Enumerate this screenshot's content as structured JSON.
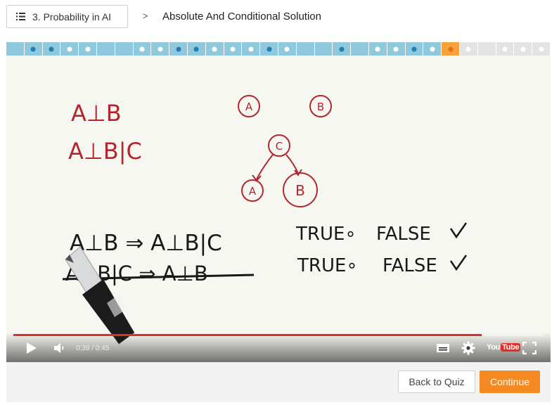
{
  "header": {
    "lesson_label": "3. Probability in AI",
    "separator": ">",
    "concept_title": "Absolute And Conditional Solution"
  },
  "progress": {
    "colors": {
      "done": "#90c9de",
      "dot_done": "#1e7fb5",
      "dot_quiz": "#ffffff",
      "current": "#f7a23b",
      "dot_current": "#e2701e",
      "todo": "#e3e3e3",
      "dot_todo": "#ffffff"
    },
    "segments": [
      {
        "state": "done",
        "dot": "none"
      },
      {
        "state": "done",
        "dot": "video"
      },
      {
        "state": "done",
        "dot": "video"
      },
      {
        "state": "done",
        "dot": "quiz"
      },
      {
        "state": "done",
        "dot": "quiz"
      },
      {
        "state": "done",
        "dot": "none"
      },
      {
        "state": "done",
        "dot": "none"
      },
      {
        "state": "done",
        "dot": "quiz"
      },
      {
        "state": "done",
        "dot": "quiz"
      },
      {
        "state": "done",
        "dot": "video"
      },
      {
        "state": "done",
        "dot": "video"
      },
      {
        "state": "done",
        "dot": "quiz"
      },
      {
        "state": "done",
        "dot": "quiz"
      },
      {
        "state": "done",
        "dot": "quiz"
      },
      {
        "state": "done",
        "dot": "video"
      },
      {
        "state": "done",
        "dot": "quiz"
      },
      {
        "state": "done",
        "dot": "none"
      },
      {
        "state": "done",
        "dot": "none"
      },
      {
        "state": "done",
        "dot": "video"
      },
      {
        "state": "done",
        "dot": "none"
      },
      {
        "state": "done",
        "dot": "quiz"
      },
      {
        "state": "done",
        "dot": "quiz"
      },
      {
        "state": "done",
        "dot": "video"
      },
      {
        "state": "done",
        "dot": "quiz"
      },
      {
        "state": "current",
        "dot": "video"
      },
      {
        "state": "todo",
        "dot": "quiz"
      },
      {
        "state": "todo",
        "dot": "none"
      },
      {
        "state": "todo",
        "dot": "quiz"
      },
      {
        "state": "todo",
        "dot": "quiz"
      },
      {
        "state": "todo",
        "dot": "quiz"
      }
    ]
  },
  "video": {
    "board": {
      "line1": "A⊥B",
      "line2": "A⊥B|C",
      "node_a": "A",
      "node_b": "B",
      "node_c": "C",
      "node_a2": "A",
      "node_b2": "B",
      "stmt1_left": "A⊥B ⇒ A⊥B|C",
      "stmt1_true": "TRUE∘",
      "stmt1_false": "FALSE",
      "stmt2_left": "A⊥B|C ⇒ A⊥B",
      "stmt2_true": "TRUE∘",
      "stmt2_false": "FALSE"
    },
    "time": "0:39 / 0:45",
    "played_fraction": 0.886,
    "logo_left": "You",
    "logo_right": "Tube"
  },
  "footer": {
    "back_label": "Back to Quiz",
    "continue_label": "Continue"
  }
}
